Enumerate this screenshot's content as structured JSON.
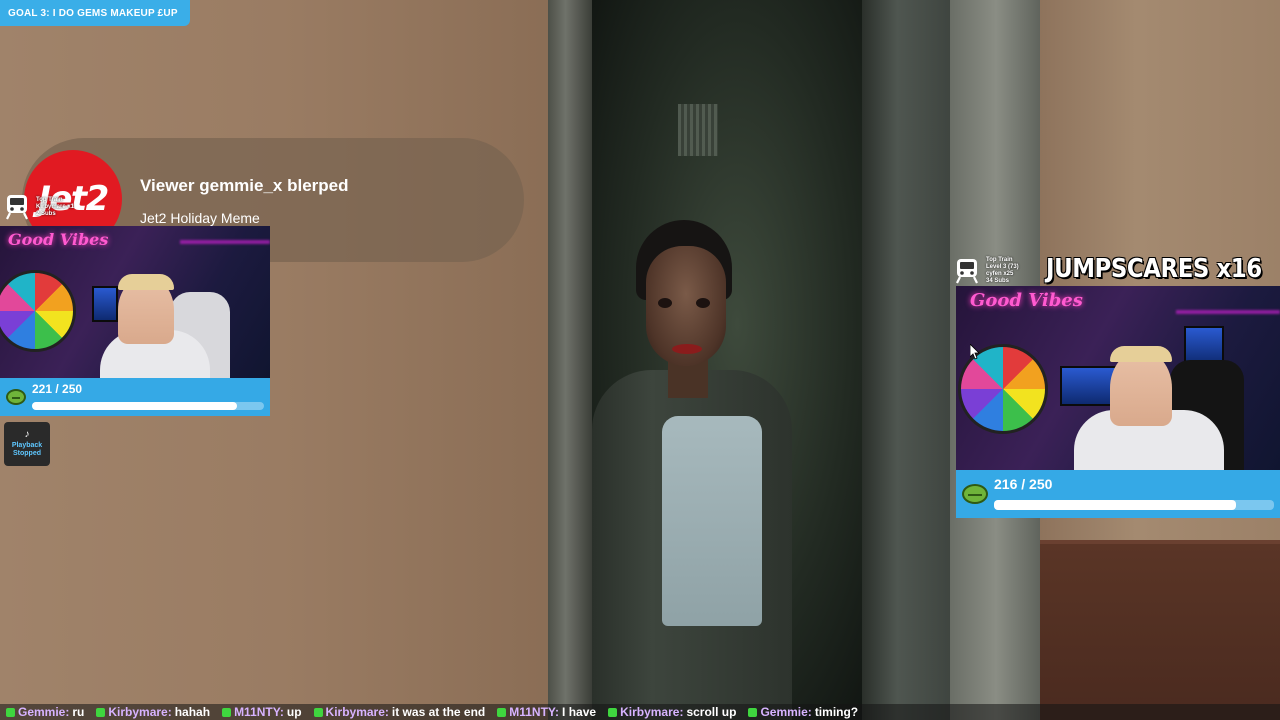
{
  "goal": {
    "text": "GOAL 3: I DO GEMS MAKEUP   £UP"
  },
  "alert": {
    "logo_text": "Jet2",
    "title": "Viewer gemmie_x blerped",
    "subtitle": "Jet2 Holiday Meme"
  },
  "left_cam": {
    "train": {
      "line1": "Top Train",
      "line2": "Kirbymare x1",
      "line3": "2 Subs"
    },
    "neon_sign": "Good Vibes",
    "progress": {
      "label": "221 / 250",
      "current": 221,
      "max": 250
    }
  },
  "playback": {
    "icon": "♪",
    "label": "Playback Stopped"
  },
  "right_cam": {
    "train": {
      "line1": "Top Train",
      "line2": "Level 3  (73)",
      "line3": "cyfen x25",
      "line4": "34 Subs"
    },
    "counter": "JUMPSCARES  x16",
    "neon_sign": "Good Vibes",
    "progress": {
      "label": "216 / 250",
      "current": 216,
      "max": 250
    }
  },
  "ticker": [
    {
      "user": "Gemmie",
      "msg": "ru"
    },
    {
      "user": "Kirbymare",
      "msg": "hahah"
    },
    {
      "user": "M11NTY",
      "msg": "up"
    },
    {
      "user": "Kirbymare",
      "msg": "it was at the end"
    },
    {
      "user": "M11NTY",
      "msg": "I have"
    },
    {
      "user": "Kirbymare",
      "msg": "scroll up"
    },
    {
      "user": "Gemmie",
      "msg": "timing?"
    }
  ],
  "colors": {
    "accent": "#3aaee8",
    "alert_logo": "#e11a22",
    "neon": "#ff5ad0",
    "frog": "#6fb43a"
  }
}
